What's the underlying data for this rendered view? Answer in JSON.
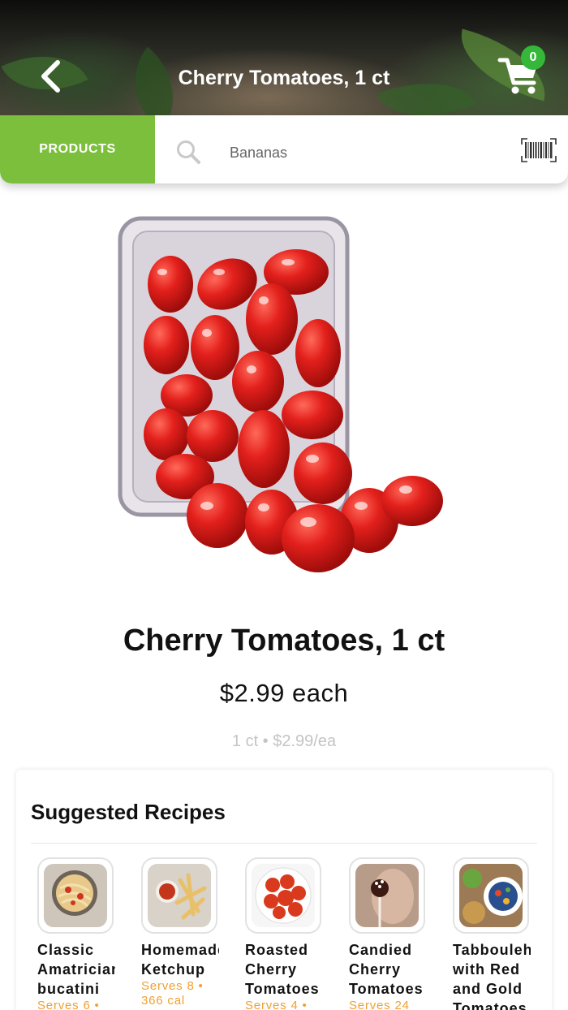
{
  "header": {
    "title": "Cherry Tomatoes, 1 ct",
    "cart_count": "0",
    "back_icon": "chevron-left-icon",
    "cart_icon": "cart-icon"
  },
  "search": {
    "tab_label": "PRODUCTS",
    "placeholder": "Bananas",
    "search_icon": "search-icon",
    "barcode_icon": "barcode-icon"
  },
  "product": {
    "title": "Cherry Tomatoes, 1 ct",
    "price": "$2.99 each",
    "unit_info": "1 ct • $2.99/ea"
  },
  "recipes": {
    "heading": "Suggested Recipes",
    "items": [
      {
        "name": "Classic Amatriciana bucatini",
        "meta": "Serves 6 •"
      },
      {
        "name": "Homemade Ketchup",
        "meta": "Serves 8 • 366 cal"
      },
      {
        "name": "Roasted Cherry Tomatoes",
        "meta": "Serves 4 •"
      },
      {
        "name": "Candied Cherry Tomatoes",
        "meta": "Serves 24"
      },
      {
        "name": "Tabbouleh with Red and Gold Tomatoes",
        "meta": ""
      }
    ]
  },
  "colors": {
    "accent_green": "#7cbf3c",
    "badge_green": "#35b83a",
    "meta_orange": "#f0a030"
  }
}
